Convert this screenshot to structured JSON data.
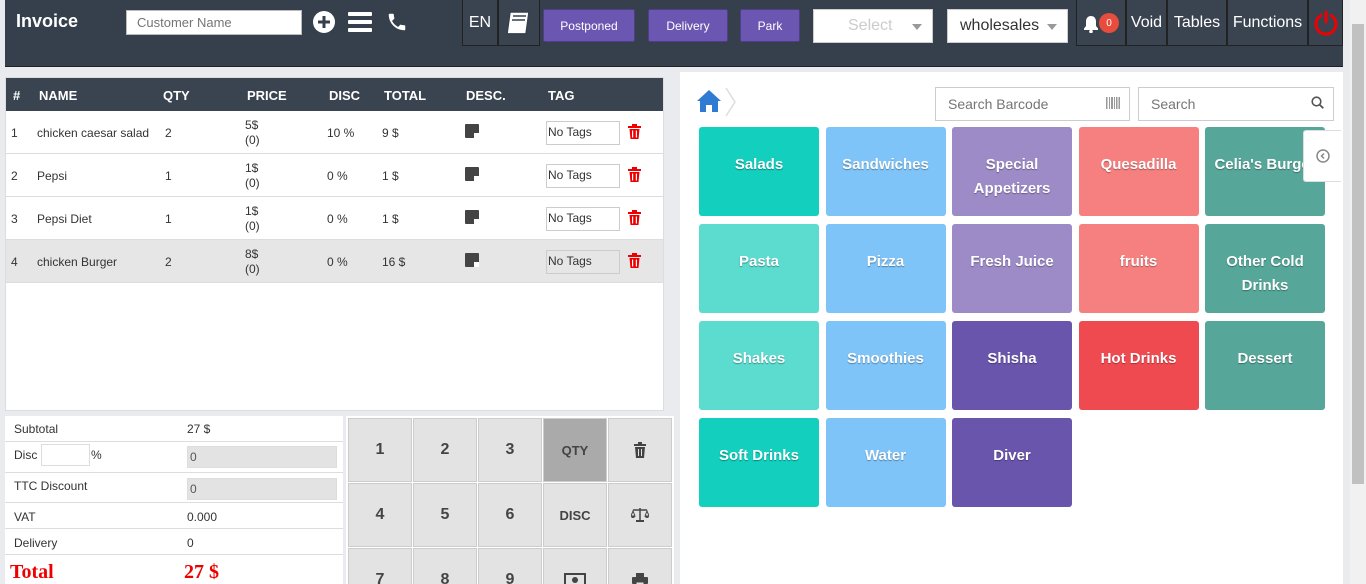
{
  "topbar": {
    "title": "Invoice",
    "customer_placeholder": "Customer Name",
    "lang": "EN",
    "postponed": "Postponed",
    "delivery": "Delivery",
    "park": "Park",
    "select_placeholder": "Select",
    "price_list": "wholesales",
    "notif_count": "0",
    "void": "Void",
    "tables": "Tables",
    "functions": "Functions"
  },
  "invoice": {
    "headers": {
      "num": "#",
      "name": "NAME",
      "qty": "QTY",
      "price": "PRICE",
      "disc": "DISC",
      "total": "TOTAL",
      "desc": "DESC.",
      "tag": "TAG"
    },
    "rows": [
      {
        "n": "1",
        "name": "chicken caesar salad",
        "qty": "2",
        "price": "5$",
        "price_sub": "(0)",
        "disc": "10 %",
        "total": "9 $",
        "tag": "No Tags"
      },
      {
        "n": "2",
        "name": "Pepsi",
        "qty": "1",
        "price": "1$",
        "price_sub": "(0)",
        "disc": "0 %",
        "total": "1 $",
        "tag": "No Tags"
      },
      {
        "n": "3",
        "name": "Pepsi Diet",
        "qty": "1",
        "price": "1$",
        "price_sub": "(0)",
        "disc": "0 %",
        "total": "1 $",
        "tag": "No Tags"
      },
      {
        "n": "4",
        "name": "chicken Burger",
        "qty": "2",
        "price": "8$",
        "price_sub": "(0)",
        "disc": "0 %",
        "total": "16 $",
        "tag": "No Tags"
      }
    ],
    "selected_row": 4
  },
  "summary": {
    "subtotal_label": "Subtotal",
    "subtotal": "27 $",
    "disc_label": "Disc",
    "disc_pct": "%",
    "disc_value": "0",
    "ttc_label": "TTC Discount",
    "ttc_value": "0",
    "vat_label": "VAT",
    "vat_value": "0.000",
    "delivery_label": "Delivery",
    "delivery_value": "0",
    "total_label": "Total",
    "total_value": "27 $"
  },
  "numpad": {
    "k1": "1",
    "k2": "2",
    "k3": "3",
    "qty": "QTY",
    "k4": "4",
    "k5": "5",
    "k6": "6",
    "disc": "DISC",
    "k7": "7",
    "k8": "8",
    "k9": "9"
  },
  "right": {
    "barcode_placeholder": "Search Barcode",
    "search_placeholder": "Search",
    "categories": [
      {
        "label": "Salads",
        "color": "#12cfbe"
      },
      {
        "label": "Sandwiches",
        "color": "#7fc4f8"
      },
      {
        "label": "Special Appetizers",
        "color": "#9d8bc8"
      },
      {
        "label": "Quesadilla",
        "color": "#f68080"
      },
      {
        "label": "Celia's Burger",
        "color": "#56a79a"
      },
      {
        "label": "Pasta",
        "color": "#5cdccf"
      },
      {
        "label": "Pizza",
        "color": "#7fc4f8"
      },
      {
        "label": "Fresh Juice",
        "color": "#9d8bc8"
      },
      {
        "label": "fruits",
        "color": "#f68080"
      },
      {
        "label": "Other Cold Drinks",
        "color": "#56a79a"
      },
      {
        "label": "Shakes",
        "color": "#5cdccf"
      },
      {
        "label": "Smoothies",
        "color": "#7fc4f8"
      },
      {
        "label": "Shisha",
        "color": "#6a55ad"
      },
      {
        "label": "Hot Drinks",
        "color": "#f04a51"
      },
      {
        "label": "Dessert",
        "color": "#56a79a"
      },
      {
        "label": "Soft Drinks",
        "color": "#12cfbe"
      },
      {
        "label": "Water",
        "color": "#7fc4f8"
      },
      {
        "label": "Diver",
        "color": "#6a55ad"
      }
    ]
  }
}
